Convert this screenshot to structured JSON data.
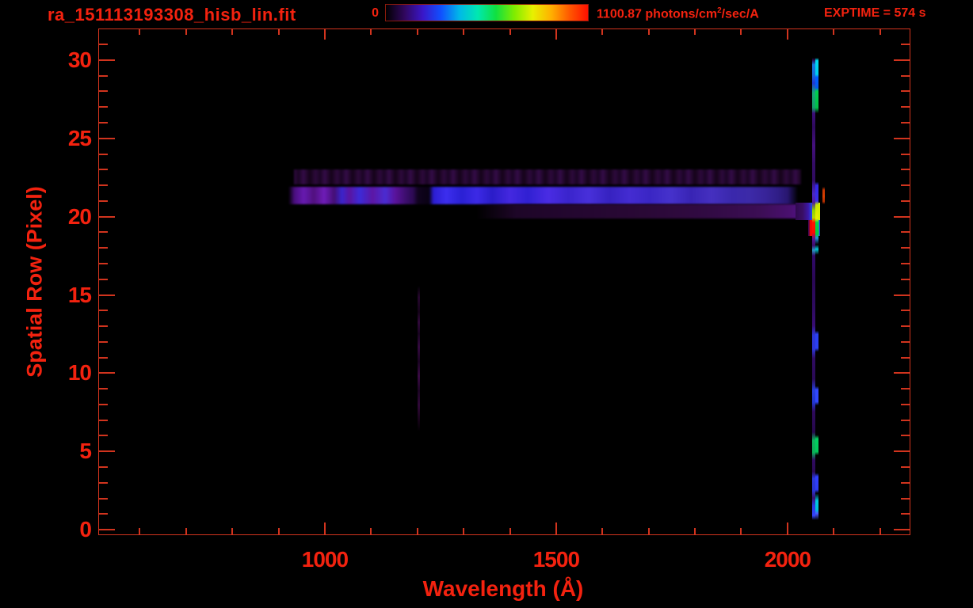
{
  "header": {
    "title": "ra_151113193308_hisb_lin.fit",
    "exptime": "EXPTIME = 574 s",
    "colorbar": {
      "min_label": "0",
      "max_label_pre": "1100.87 photons/cm",
      "max_label_sup": "2",
      "max_label_post": "/sec/A"
    }
  },
  "colors": {
    "background": "#000000",
    "text": "#f3220f",
    "axis": "#d2341e"
  },
  "chart_data": {
    "type": "heatmap",
    "title": "ra_151113193308_hisb_lin.fit",
    "xlabel": "Wavelength (Å)",
    "ylabel": "Spatial Row (Pixel)",
    "xlim": [
      512,
      2264
    ],
    "ylim": [
      -0.3,
      31.97
    ],
    "xticks": [
      1000,
      1500,
      2000
    ],
    "yticks": [
      0,
      5,
      10,
      15,
      20,
      25,
      30
    ],
    "xminor_step": 100,
    "yminor_step": 1,
    "grid": false,
    "legend": false,
    "exptime_seconds": 574,
    "colorbar": {
      "min": 0,
      "max": 1100.87,
      "units": "photons/cm^2/sec/A",
      "colormap_stops": [
        "#000000",
        "#30075c",
        "#3a16c8",
        "#1050ff",
        "#00b8e8",
        "#00e8b0",
        "#10e040",
        "#80ec00",
        "#e8f000",
        "#ffb000",
        "#ff5800",
        "#ff1000"
      ]
    },
    "features": [
      {
        "name": "upper-faint-band",
        "desc": "faint secondary spectral trace, rows 22-23, ~930-2030 A",
        "wl0": 933,
        "wl1": 2029,
        "row0": 22.05,
        "row1": 23.0,
        "blur": 1,
        "paint": "repeating-linear-gradient(90deg,#2e0a3e 0px,#1b0524 6px,#340c48 12px,#140318 20px,#2c0a3a 27px)"
      },
      {
        "name": "main-spectrum-band",
        "desc": "main stellar spectrum trace, rows 21-22, ~920-2020 A, gap at Lyman-alpha ~1216 A",
        "wl0": 921,
        "wl1": 2022,
        "row0": 20.8,
        "row1": 21.9,
        "blur": 1,
        "paint": "linear-gradient(90deg,rgba(40,8,70,0) 0%,#4a0e7e 1.2%,#661ab0 3%,#50107e 5%,#6e1cb8 7%,#440e74 9%,#3a24cc 10.5%,#5a14a0 12%,#3c2ad8 14%,#5c16a4 16.5%,#4a2cd2 19%,#5a129a 21%,#3c0e6e 23%,#2c0a52 24.5%,#10031e 25.4%,#0a0214 27.6%,#2c1ed2 28.5%,#3c2eee 31%,#2a20d4 34%,#3c2ae6 37%,#2a1cc8 40%,#4428e0 43.5%,#3020d2 47%,#4a2ce4 51%,#3a24cc 55%,#4830da 59%,#3622c0 63%,#442cd2 67%,#3a26c4 71%,#4632cc 75%,#3824b4 79%,#4530c0 83%,#3a28ac 87%,#3c2aa8 90.5%,#38249a 93.5%,#301e88 96%,#281670 98%,rgba(30,10,80,0) 100%)"
      },
      {
        "name": "lower-faint-band",
        "desc": "faint lower wing of trace, rows 20-21, brightening toward 2050 A",
        "wl0": 1327,
        "wl1": 2050,
        "row0": 19.88,
        "row1": 20.8,
        "blur": 1,
        "paint": "linear-gradient(90deg,rgba(30,6,40,0) 0%,#1e0628 12%,#240730 30%,#2a0936 50%,#320b44 70%,#3c0e55 85%,#4a1070 94%,#58139a 100%)"
      },
      {
        "name": "line-blowup-wedge",
        "desc": "bright flare where trace meets emission line, rainbow saturation ramp",
        "wl0": 2017,
        "wl1": 2070,
        "row0": 19.8,
        "row1": 20.9,
        "paint": "linear-gradient(90deg,#30094e 0%,#3a0f66 30%,#3c18a8 52%,#2748e8 66%,#00a8d8 74%,#00c853 82%,#7ce800 90%,#e8f400 97%,#c8e800 100%)"
      },
      {
        "name": "saturated-red-spot",
        "desc": "saturated (max flux) red block at row ~19, ~2055 A",
        "wl0": 2045,
        "wl1": 2070,
        "row0": 18.75,
        "row1": 19.8,
        "paint": "linear-gradient(90deg,#40095e 0%,#58024a 8%,#f50800 16%,#ff0d00 70%,#e82000 74%,#00d048 78%,#00e05a 88%,#3050ff 93%,#2a10a0 100%)"
      },
      {
        "name": "emission-line-core",
        "desc": "vertical emission/airglow line at ~2060 A spanning all spatial rows",
        "wl0": 2053,
        "wl1": 2061,
        "row0": 0.6,
        "row1": 30.15,
        "paint": "linear-gradient(180deg,rgba(30,8,60,0) 0%,#28084e 0.5%,#1878e0 1.5%,#1a68d8 3.8%,#2038d8 5.5%,#18a878 7.6%,#14a06a 10.8%,#3c0e78 12%,#2e0a5e 15%,#44107e 19%,#340c66 23%,#300b60 26.5%,#3c1898 27.6%,#4a28c8 29.5%,#521aa0 31.3%,#90d400 33%,#b4dc00 34.6%,#ff1400 35.6%,#ff0a00 37.8%,#5a1490 39.2%,#3a0e6e 40.6%,#2c96c0 41.6%,#30096a 42.8%,#2a0856 48%,#2e0b60 54%,#380d74 58%,#2d36d8 60%,#2d36d8 63%,#2f0b62 65%,#2a0a56 69.5%,#2840e0 72%,#2236d0 74.6%,#2e0a5c 76.5%,#26084c 81%,#0fb45e 82.8%,#0cae58 85.4%,#300b60 87%,#2a0954 89.5%,#2c38dc 91%,#2a34d4 93.6%,#38106e 95.2%,#2a3ae0 96.8%,#3444ff 99%,rgba(50,60,200,0) 100%)"
      },
      {
        "name": "emission-line-bright-edge",
        "desc": "bright cyan/green/blue knots along right edge of emission line",
        "wl0": 2061,
        "wl1": 2067,
        "row0": 0.6,
        "row1": 30.15,
        "paint": "linear-gradient(180deg,rgba(0,0,0,0) 0%,#00d8f0 0.6%,#00ccee 3.6%,#0060ff 4.2%,#0458f0 6.5%,#00d050 7.2%,#00c048 10.8%,rgba(10,2,26,0) 12%,rgba(10,2,26,0) 26.8%,#3428e8 27.6%,#3a2ee8 31%,#c8e800 31.8%,#e8f000 34.8%,#00d848 35.6%,#00cc42 38.2%,#2090e0 39%,rgba(10,2,26,0) 40.4%,#00c8d8 41.4%,rgba(10,2,26,0) 42.6%,rgba(10,2,26,0) 59%,#2a40f0 59.8%,#2a40f0 62.8%,rgba(10,2,26,0) 63.6%,rgba(10,2,26,0) 71%,#3048ff 71.8%,#3048ff 74.4%,rgba(10,2,26,0) 75.2%,rgba(10,2,26,0) 81.6%,#00d060 82.4%,#00c858 85.2%,rgba(10,2,26,0) 86%,rgba(10,2,26,0) 89.8%,#3040ff 90.6%,#2c3cf4 93.4%,rgba(10,2,26,0) 94.2%,#00c8e0 95.8%,#00c0da 97.8%,#4858ff 98.6%,rgba(70,90,255,0) 100%)"
      },
      {
        "name": "red-dash",
        "desc": "small detached red-orange knot right of line at trace rows",
        "wl0": 2075,
        "wl1": 2081,
        "row0": 20.8,
        "row1": 21.9,
        "paint": "linear-gradient(180deg,rgba(200,48,0,0) 0%,#c83400 18%,#d84000 55%,#b02c00 85%,rgba(200,48,0,0) 100%)"
      },
      {
        "name": "lyman-alpha-residual",
        "desc": "very faint vertical residual at ~1202 A, rows 6-16",
        "wl0": 1200,
        "wl1": 1205,
        "row0": 6.3,
        "row1": 15.6,
        "paint": "linear-gradient(180deg,rgba(40,8,48,0) 0%,#26072e 8%,#140318 18%,#30093a 25%,#180420 33%,#340a40 42%,#1a0422 52%,#3a0b44 62%,#1c0524 72%,#300938 82%,#160318 92%,rgba(30,6,36,0) 100%)"
      }
    ]
  }
}
